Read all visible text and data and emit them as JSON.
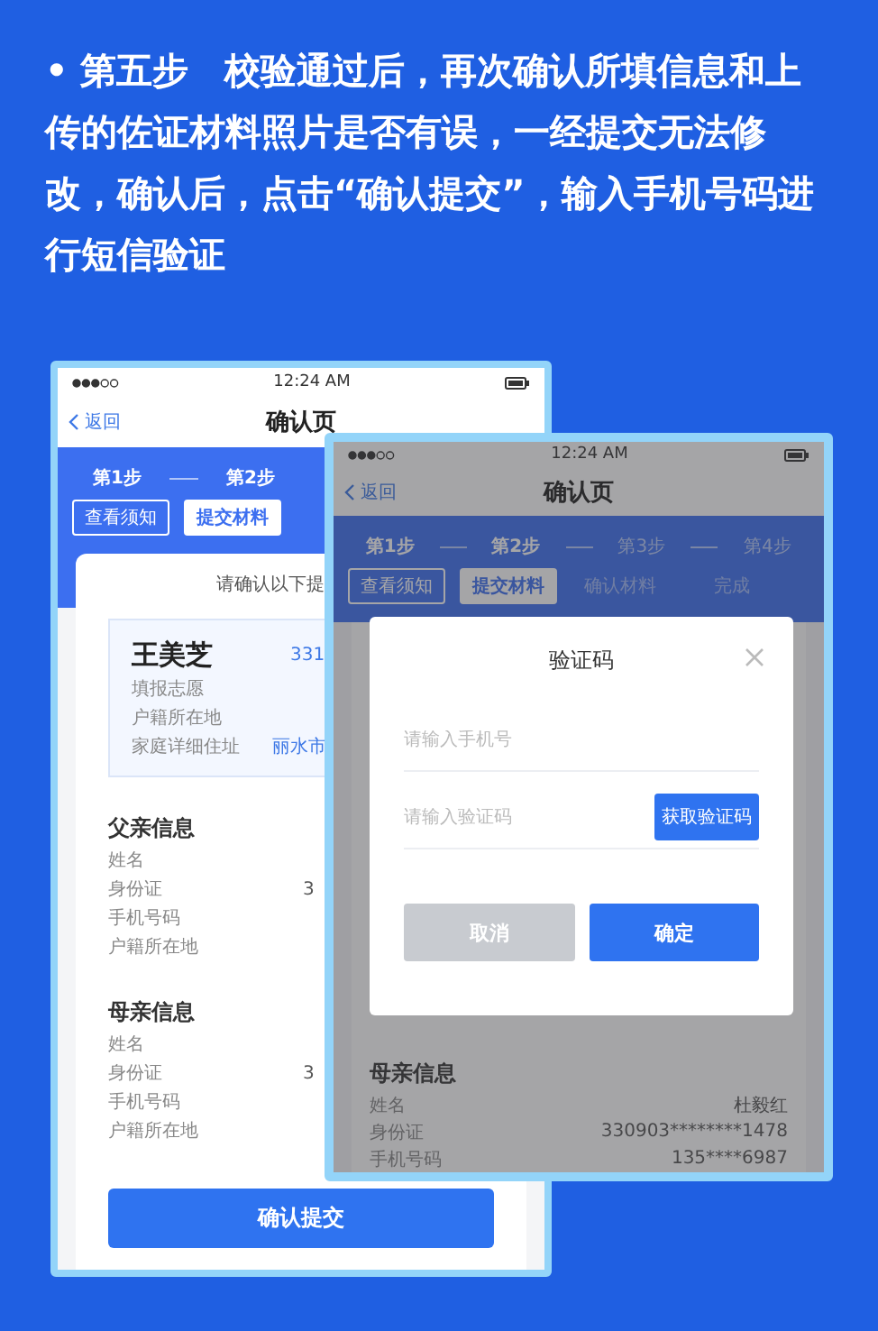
{
  "intro": "• 第五步　校验通过后，再次确认所填信息和上传的佐证材料照片是否有误，一经提交无法修改，确认后，点击“确认提交”，输入手机号码进行短信验证",
  "confirm_screen": {
    "time": "12:24 AM",
    "back": "返回",
    "title": "确认页",
    "steps": [
      {
        "label": "第1步",
        "active": true
      },
      {
        "label": "第2步",
        "active": true
      }
    ],
    "tabs": [
      {
        "label": "查看须知",
        "completed": true,
        "selected": false
      },
      {
        "label": "提交材料",
        "completed": false,
        "selected": true
      }
    ],
    "notice": "请确认以下提",
    "applicant": {
      "name": "王美芝",
      "id": "331",
      "rows": [
        {
          "label": "填报志愿"
        },
        {
          "label": "户籍所在地"
        },
        {
          "label": "家庭详细住址",
          "value": "丽水市"
        }
      ]
    },
    "sections": [
      {
        "title": "父亲信息",
        "rows": [
          {
            "label": "姓名"
          },
          {
            "label": "身份证",
            "value": "3"
          },
          {
            "label": "手机号码"
          },
          {
            "label": "户籍所在地"
          }
        ]
      },
      {
        "title": "母亲信息",
        "rows": [
          {
            "label": "姓名"
          },
          {
            "label": "身份证",
            "value": "3"
          },
          {
            "label": "手机号码"
          },
          {
            "label": "户籍所在地"
          }
        ]
      }
    ],
    "submit": "确认提交"
  },
  "verify_screen": {
    "time": "12:24 AM",
    "back": "返回",
    "title": "确认页",
    "steps": [
      {
        "label": "第1步",
        "active": true
      },
      {
        "label": "第2步",
        "active": true
      },
      {
        "label": "第3步",
        "active": false
      },
      {
        "label": "第4步",
        "active": false
      }
    ],
    "tabs": [
      {
        "label": "查看须知",
        "completed": true,
        "selected": false
      },
      {
        "label": "提交材料",
        "completed": false,
        "selected": true
      },
      {
        "label": "确认材料",
        "completed": false,
        "selected": false
      },
      {
        "label": "完成",
        "completed": false,
        "selected": false
      }
    ],
    "sections": [
      {
        "title": "母亲信息",
        "rows": [
          {
            "label": "姓名",
            "value": "杜毅红"
          },
          {
            "label": "身份证",
            "value": "330903********1478"
          },
          {
            "label": "手机号码",
            "value": "135****6987"
          }
        ]
      }
    ],
    "dialog": {
      "title": "验证码",
      "phone_placeholder": "请输入手机号",
      "code_placeholder": "请输入验证码",
      "get_code": "获取验证码",
      "cancel": "取消",
      "confirm": "确定"
    }
  }
}
